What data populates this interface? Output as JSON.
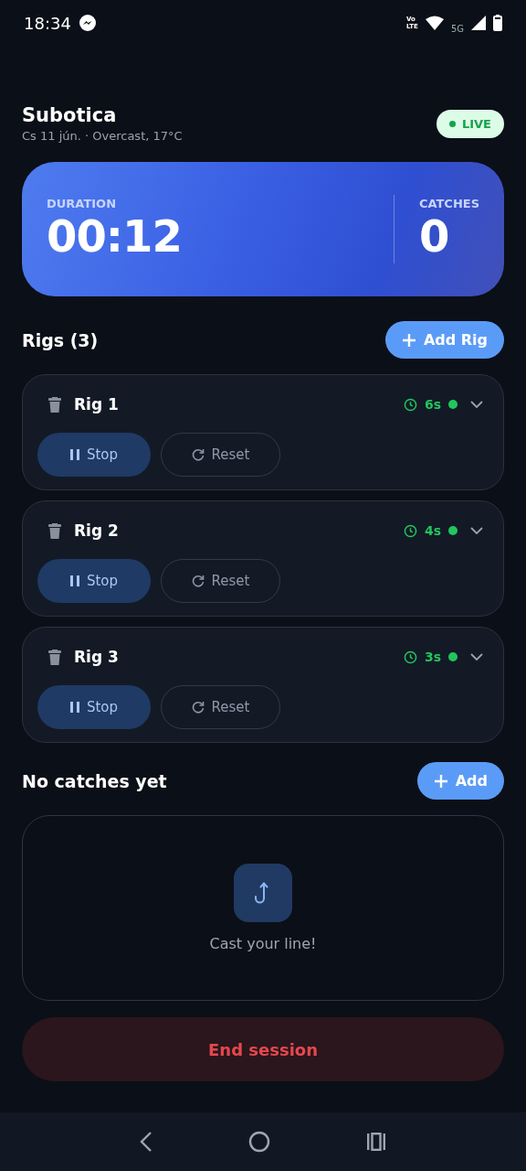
{
  "status_bar": {
    "time": "18:34",
    "volte_top": "Vo",
    "volte_bottom": "LTE",
    "network": "5G"
  },
  "header": {
    "title": "Subotica",
    "subtitle": "Cs 11 jún. · Overcast, 17°C",
    "badge": "LIVE"
  },
  "stats": [
    {
      "label": "DURATION",
      "value": "00:12"
    },
    {
      "label": "CATCHES",
      "value": "0"
    }
  ],
  "rigs_section": {
    "title": "Rigs (3)",
    "add_button": "Add Rig"
  },
  "rigs": [
    {
      "name": "Rig 1",
      "elapsed": "6s",
      "running": true,
      "stop_button": "Stop",
      "reset_button": "Reset"
    },
    {
      "name": "Rig 2",
      "elapsed": "4s",
      "running": true,
      "stop_button": "Stop",
      "reset_button": "Reset"
    },
    {
      "name": "Rig 3",
      "elapsed": "3s",
      "running": true,
      "stop_button": "Stop",
      "reset_button": "Reset"
    }
  ],
  "catches_section": {
    "title": "No catches yet",
    "add_button": "Add",
    "empty_message": "Cast your line!"
  },
  "end_button": "End session"
}
